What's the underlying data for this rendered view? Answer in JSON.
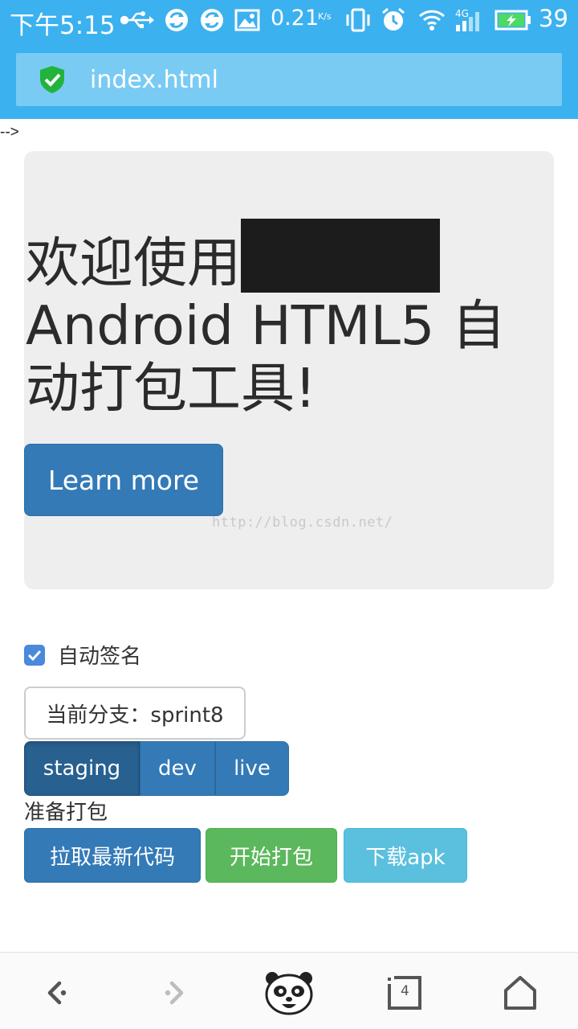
{
  "status_bar": {
    "time": "下午5:15",
    "net_speed": "0.21",
    "net_unit": "K/s",
    "network_type": "4G",
    "battery": "39",
    "bg_color": "#3cb1ef"
  },
  "url_bar": {
    "url": "index.html",
    "secure_icon": "shield-check-icon"
  },
  "stray_text": "-->",
  "jumbotron": {
    "title_part1": "欢迎使用",
    "title_part2": "Android HTML5 自动打包工具!",
    "learn_more": "Learn more"
  },
  "watermark": "http://blog.csdn.net/",
  "form": {
    "auto_sign_label": "自动签名",
    "auto_sign_checked": true,
    "current_branch": "当前分支：sprint8",
    "env_buttons": [
      "staging",
      "dev",
      "live"
    ],
    "env_selected": "staging",
    "prepare_label": "准备打包",
    "actions": {
      "pull": "拉取最新代码",
      "build": "开始打包",
      "download": "下载apk"
    }
  },
  "bottom_nav": {
    "tabs_count": "4",
    "icons": [
      "back-icon",
      "forward-icon",
      "panda-icon",
      "tabs-icon",
      "home-icon"
    ]
  },
  "colors": {
    "primary": "#337ab7",
    "success": "#5cb85c",
    "info": "#5bc0de"
  }
}
